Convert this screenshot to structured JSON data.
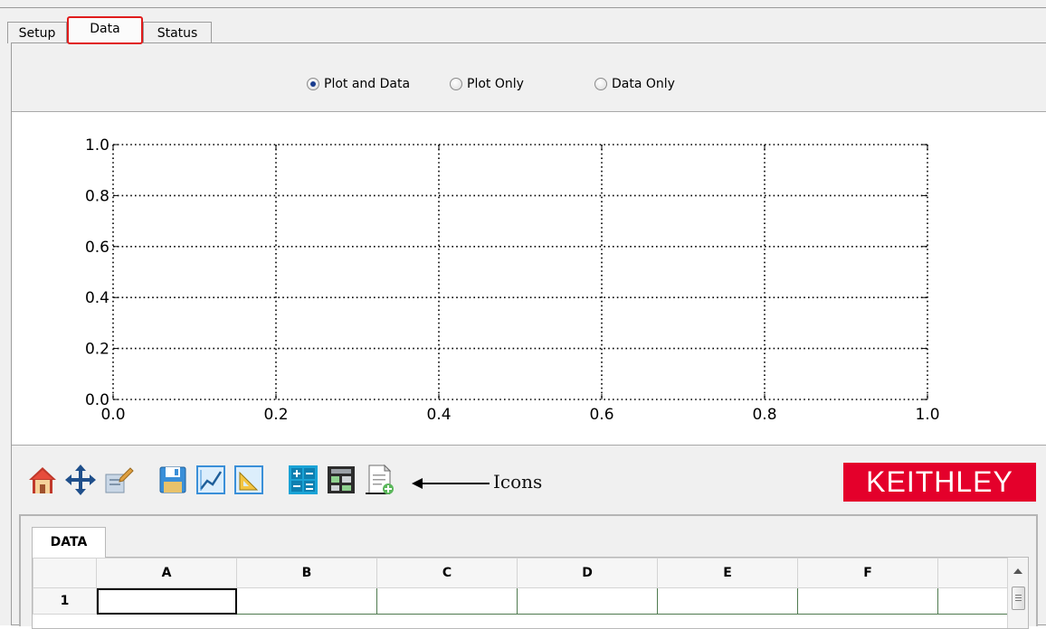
{
  "tabs": [
    {
      "label": "Setup",
      "active": false
    },
    {
      "label": "Data",
      "active": true
    },
    {
      "label": "Status",
      "active": false
    }
  ],
  "view_options": {
    "options": [
      "Plot and Data",
      "Plot Only",
      "Data Only"
    ],
    "selected": "Plot and Data"
  },
  "chart_data": {
    "type": "line",
    "series": [],
    "xlim": [
      0.0,
      1.0
    ],
    "ylim": [
      0.0,
      1.0
    ],
    "xticks": [
      "0.0",
      "0.2",
      "0.4",
      "0.6",
      "0.8",
      "1.0"
    ],
    "yticks": [
      "0.0",
      "0.2",
      "0.4",
      "0.6",
      "0.8",
      "1.0"
    ],
    "grid": true,
    "grid_style": "dotted"
  },
  "toolbar": {
    "icons": [
      "home-icon",
      "pan-move-icon",
      "edit-properties-icon",
      "save-icon",
      "line-chart-icon",
      "ruler-icon",
      "calculator-icon",
      "table-data-icon",
      "export-document-icon"
    ],
    "annotation_label": "Icons",
    "logo_text": "KEITHLEY",
    "logo_color": "#e4002b"
  },
  "sheet": {
    "tab_label": "DATA",
    "columns": [
      "A",
      "B",
      "C",
      "D",
      "E",
      "F",
      ""
    ],
    "rows": [
      {
        "label": "1",
        "cells": [
          "",
          "",
          "",
          "",
          "",
          "",
          ""
        ]
      }
    ]
  }
}
